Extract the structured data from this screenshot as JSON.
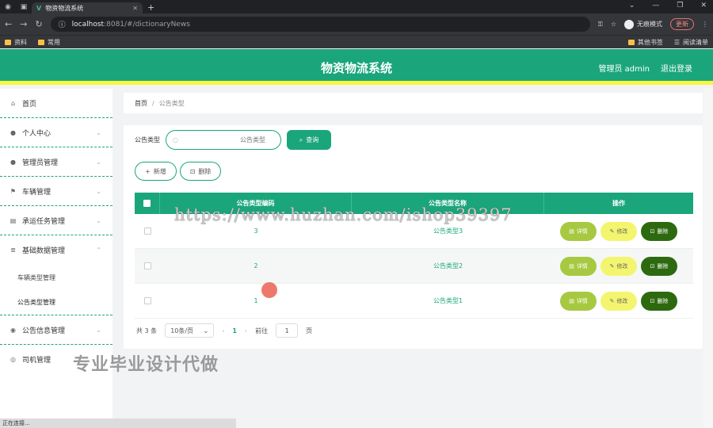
{
  "browser": {
    "tab_title": "物资物流系统",
    "url_host": "localhost",
    "url_path": ":8081/#/dictionaryNews",
    "incognito_label": "无痕模式",
    "update_label": "更新",
    "bookmarks": [
      "资料",
      "常用"
    ],
    "bookmarks_right": [
      "其他书签",
      "阅读清单"
    ],
    "status_text": "正在连接..."
  },
  "header": {
    "title": "物资物流系统",
    "user_label": "管理员 admin",
    "logout_label": "退出登录"
  },
  "sidebar": {
    "items": [
      {
        "label": "首页"
      },
      {
        "label": "个人中心"
      },
      {
        "label": "管理员管理"
      },
      {
        "label": "车辆管理"
      },
      {
        "label": "承运任务管理"
      },
      {
        "label": "基础数据管理"
      },
      {
        "label": "公告信息管理"
      },
      {
        "label": "司机管理"
      }
    ],
    "sub_items": [
      {
        "label": "车辆类型管理"
      },
      {
        "label": "公告类型管理"
      }
    ]
  },
  "breadcrumb": {
    "home": "首页",
    "sep": "/",
    "current": "公告类型"
  },
  "search": {
    "label": "公告类型",
    "placeholder": "公告类型",
    "query_label": "查询"
  },
  "actions": {
    "add_label": "新增",
    "delete_label": "删除"
  },
  "table": {
    "headers": [
      "公告类型编码",
      "公告类型名称",
      "操作"
    ],
    "rows": [
      {
        "code": "3",
        "name": "公告类型3"
      },
      {
        "code": "2",
        "name": "公告类型2"
      },
      {
        "code": "1",
        "name": "公告类型1"
      }
    ],
    "op_detail": "详情",
    "op_edit": "修改",
    "op_delete": "删除"
  },
  "pager": {
    "total": "共 3 条",
    "page_size": "10条/页",
    "current_page": "1",
    "goto_label": "前往",
    "goto_value": "1",
    "page_suffix": "页"
  },
  "overlay": {
    "watermark": "https://www.huzhan.com/ishop39397",
    "promo": "专业毕业设计代做"
  },
  "colors": {
    "primary": "#1aa67a",
    "header_accent": "#f7f742",
    "detail": "#a7c941",
    "edit": "#f4f56e",
    "delete": "#2d6a0f"
  }
}
